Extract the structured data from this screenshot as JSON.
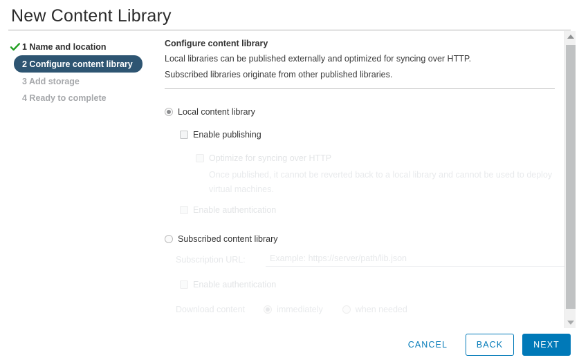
{
  "window": {
    "title": "New Content Library"
  },
  "colors": {
    "accent_blue": "#0079b8",
    "active_step_bg": "#2e5572",
    "check_green": "#1f9e1f",
    "disabled_text": "#e2e4e6",
    "scrollbar_thumb": "#c0c2c3"
  },
  "steps": [
    {
      "number": "1",
      "label": "1 Name and location",
      "state": "done"
    },
    {
      "number": "2",
      "label": "2 Configure content library",
      "state": "active"
    },
    {
      "number": "3",
      "label": "3 Add storage",
      "state": "pending"
    },
    {
      "number": "4",
      "label": "4 Ready to complete",
      "state": "pending"
    }
  ],
  "panel": {
    "heading": "Configure content library",
    "description_line1": "Local libraries can be published externally and optimized for syncing over HTTP.",
    "description_line2": "Subscribed libraries originate from other published libraries."
  },
  "options": {
    "local": {
      "label": "Local content library",
      "selected": true,
      "enable_publishing": {
        "label": "Enable publishing",
        "checked": false,
        "enabled": true
      },
      "optimize_http": {
        "label": "Optimize for syncing over HTTP",
        "checked": false,
        "enabled": false
      },
      "optimize_note": "Once published, it cannot be reverted back to a local library and cannot be used to deploy virtual machines.",
      "enable_authentication": {
        "label": "Enable authentication",
        "checked": false,
        "enabled": false
      }
    },
    "subscribed": {
      "label": "Subscribed content library",
      "selected": false,
      "subscription_url": {
        "label": "Subscription URL:",
        "value": "",
        "placeholder": "Example: https://server/path/lib.json"
      },
      "enable_authentication": {
        "label": "Enable authentication",
        "checked": false,
        "enabled": false
      },
      "download_content": {
        "label": "Download content",
        "choices": [
          {
            "label": "immediately",
            "selected": true
          },
          {
            "label": "when needed",
            "selected": false
          }
        ]
      }
    }
  },
  "scrollbar": {
    "up_arrow": "scroll-up-arrow",
    "down_arrow": "scroll-down-arrow"
  },
  "footer": {
    "cancel_label": "CANCEL",
    "back_label": "BACK",
    "next_label": "NEXT"
  }
}
